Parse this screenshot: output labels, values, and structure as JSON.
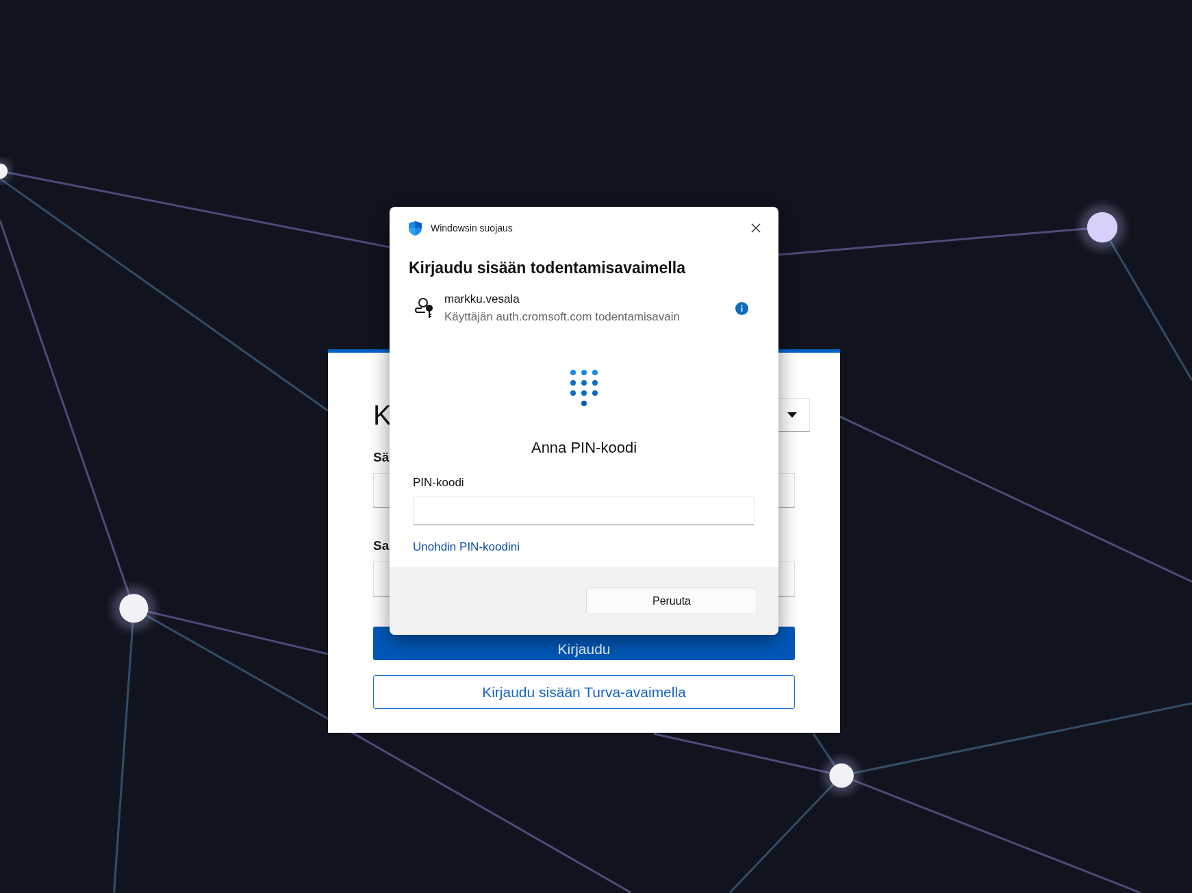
{
  "login_card": {
    "title": "K",
    "fields": [
      {
        "label": "Sä"
      },
      {
        "label": "Sa"
      }
    ],
    "buttons": [
      {
        "label": "Kirjaudu",
        "kind": "primary"
      },
      {
        "label": "Kirjaudu sisään Turva-avaimella",
        "kind": "outline"
      }
    ]
  },
  "dialog": {
    "app_name": "Windowsin suojaus",
    "heading": "Kirjaudu sisään todentamisavaimella",
    "account": {
      "name": "markku.vesala",
      "description": "Käyttäjän auth.cromsoft.com todentamisavain"
    },
    "prompt": "Anna PIN-koodi",
    "pin_field": {
      "label": "PIN-koodi"
    },
    "link": "Unohdin PIN-koodini",
    "buttons": [
      "Peruuta"
    ]
  }
}
